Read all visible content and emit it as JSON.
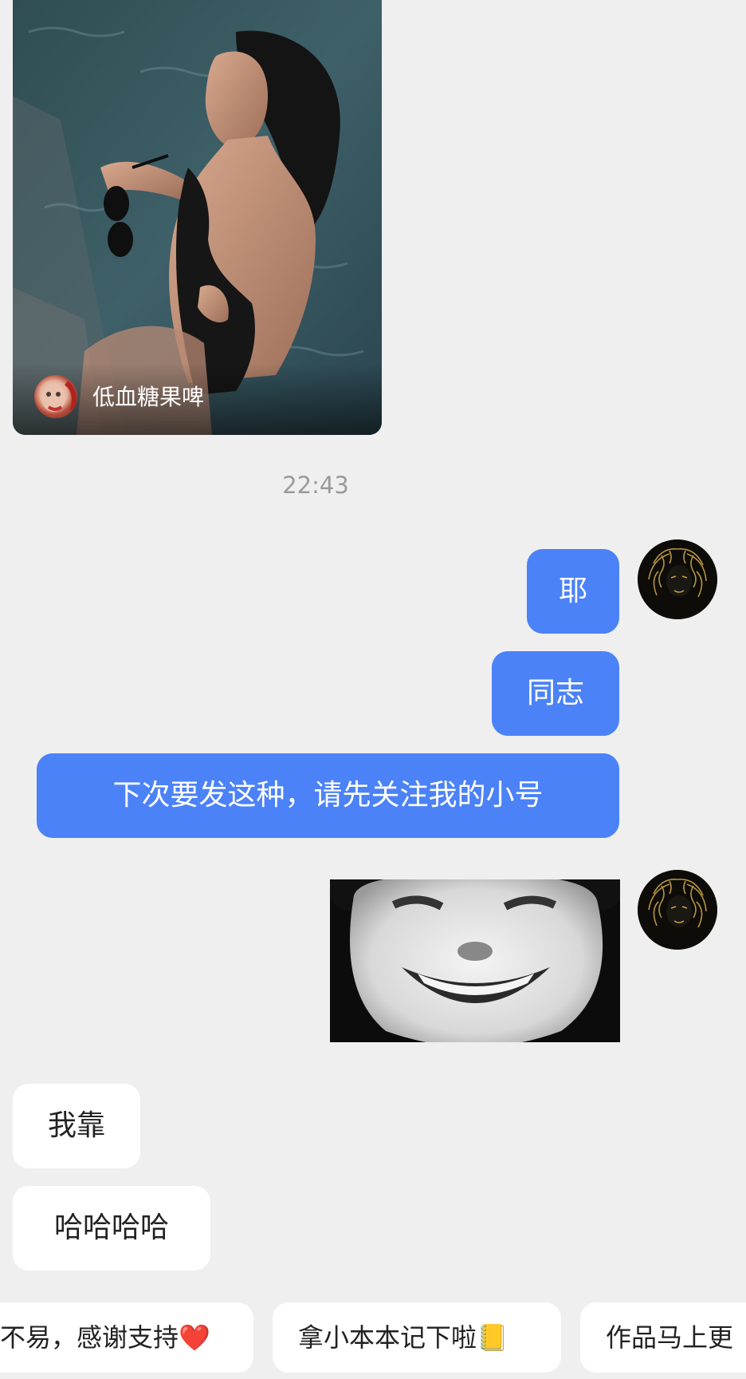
{
  "shared_post": {
    "author_name": "低血糖果啤",
    "image_icon": "photo-image"
  },
  "timestamp": "22:43",
  "messages": {
    "m1": "耶",
    "m2": "同志",
    "m3": "下次要发这种，请先关注我的小号",
    "sticker_icon": "laughing-face-sticker",
    "m4": "我靠",
    "m5": "哈哈哈哈"
  },
  "quick_replies": [
    "不易，感谢支持❤️",
    "拿小本本记下啦📒",
    "作品马上更"
  ],
  "colors": {
    "background": "#efeff0",
    "my_bubble": "#4b82f7",
    "their_bubble": "#ffffff",
    "timestamp": "#9a9a9a"
  }
}
